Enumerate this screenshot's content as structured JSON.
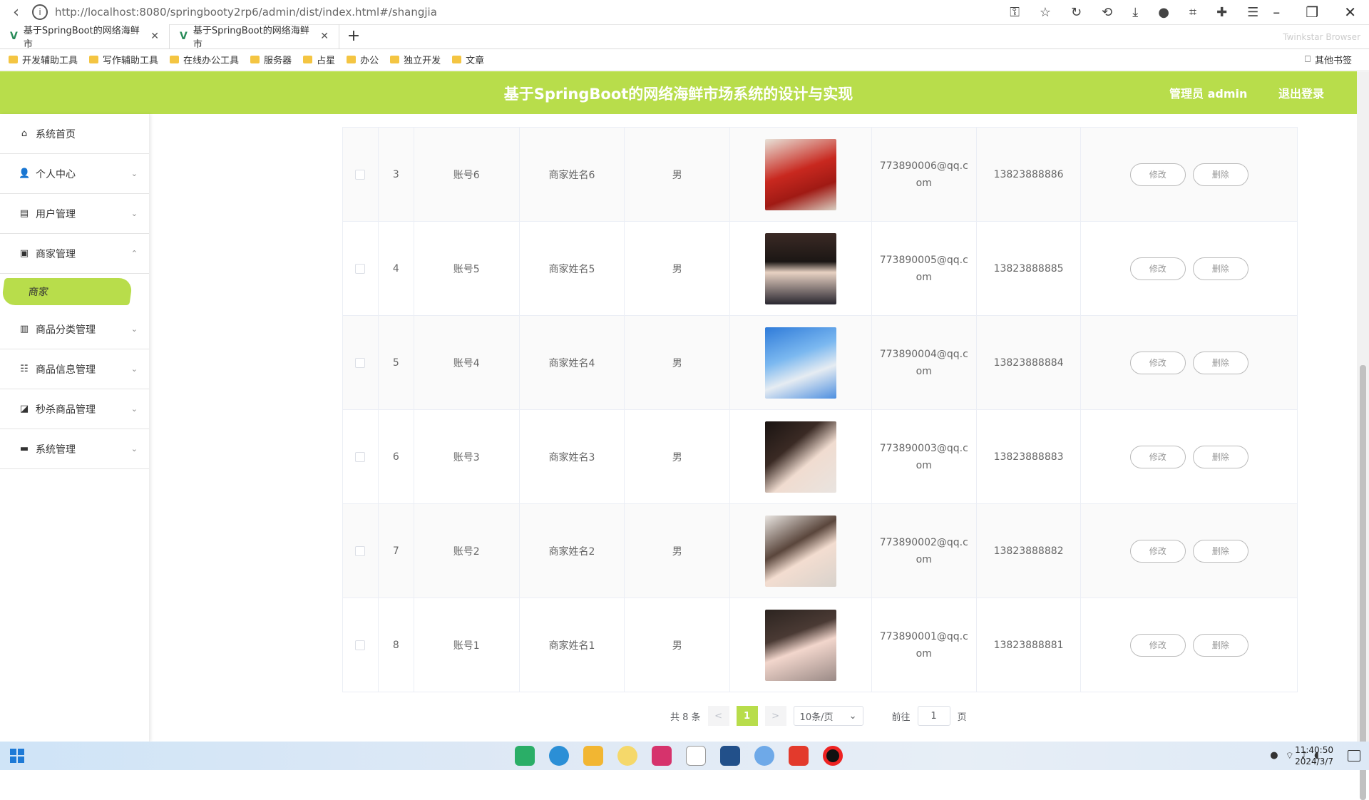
{
  "browser": {
    "url": "http://localhost:8080/springbooty2rp6/admin/dist/index.html#/shangjia",
    "tabs": [
      {
        "label": "基于SpringBoot的网络海鲜市"
      },
      {
        "label": "基于SpringBoot的网络海鲜市"
      }
    ],
    "brand": "Twinkstar Browser",
    "bookmarks": [
      "开发辅助工具",
      "写作辅助工具",
      "在线办公工具",
      "服务器",
      "占星",
      "办公",
      "独立开发",
      "文章"
    ],
    "other_bookmarks": "其他书签"
  },
  "header": {
    "title": "基于SpringBoot的网络海鲜市场系统的设计与实现",
    "admin": "管理员 admin",
    "logout": "退出登录"
  },
  "sidebar": {
    "items": [
      {
        "label": "系统首页",
        "icon": "home-icon"
      },
      {
        "label": "个人中心",
        "icon": "user-icon"
      },
      {
        "label": "用户管理",
        "icon": "document-icon"
      },
      {
        "label": "商家管理",
        "icon": "message-icon"
      },
      {
        "label": "商品分类管理",
        "icon": "delete-icon"
      },
      {
        "label": "商品信息管理",
        "icon": "sliders-icon"
      },
      {
        "label": "秒杀商品管理",
        "icon": "cart-icon"
      },
      {
        "label": "系统管理",
        "icon": "monitor-icon"
      }
    ],
    "active_sub": "商家"
  },
  "table": {
    "rows": [
      {
        "index": "3",
        "account": "账号6",
        "name": "商家姓名6",
        "gender": "男",
        "email": "773890006@qq.com",
        "phone": "13823888886"
      },
      {
        "index": "4",
        "account": "账号5",
        "name": "商家姓名5",
        "gender": "男",
        "email": "773890005@qq.com",
        "phone": "13823888885"
      },
      {
        "index": "5",
        "account": "账号4",
        "name": "商家姓名4",
        "gender": "男",
        "email": "773890004@qq.com",
        "phone": "13823888884"
      },
      {
        "index": "6",
        "account": "账号3",
        "name": "商家姓名3",
        "gender": "男",
        "email": "773890003@qq.com",
        "phone": "13823888883"
      },
      {
        "index": "7",
        "account": "账号2",
        "name": "商家姓名2",
        "gender": "男",
        "email": "773890002@qq.com",
        "phone": "13823888882"
      },
      {
        "index": "8",
        "account": "账号1",
        "name": "商家姓名1",
        "gender": "男",
        "email": "773890001@qq.com",
        "phone": "13823888881"
      }
    ],
    "edit_label": "修改",
    "delete_label": "删除"
  },
  "pager": {
    "total": "共 8 条",
    "prev": "<",
    "page": "1",
    "next": ">",
    "size": "10条/页",
    "goto_prefix": "前往",
    "goto_value": "1",
    "goto_suffix": "页"
  },
  "clock": {
    "time": "11:40:50",
    "date": "2024/3/7"
  },
  "colors": {
    "accent": "#b8dd4b"
  }
}
